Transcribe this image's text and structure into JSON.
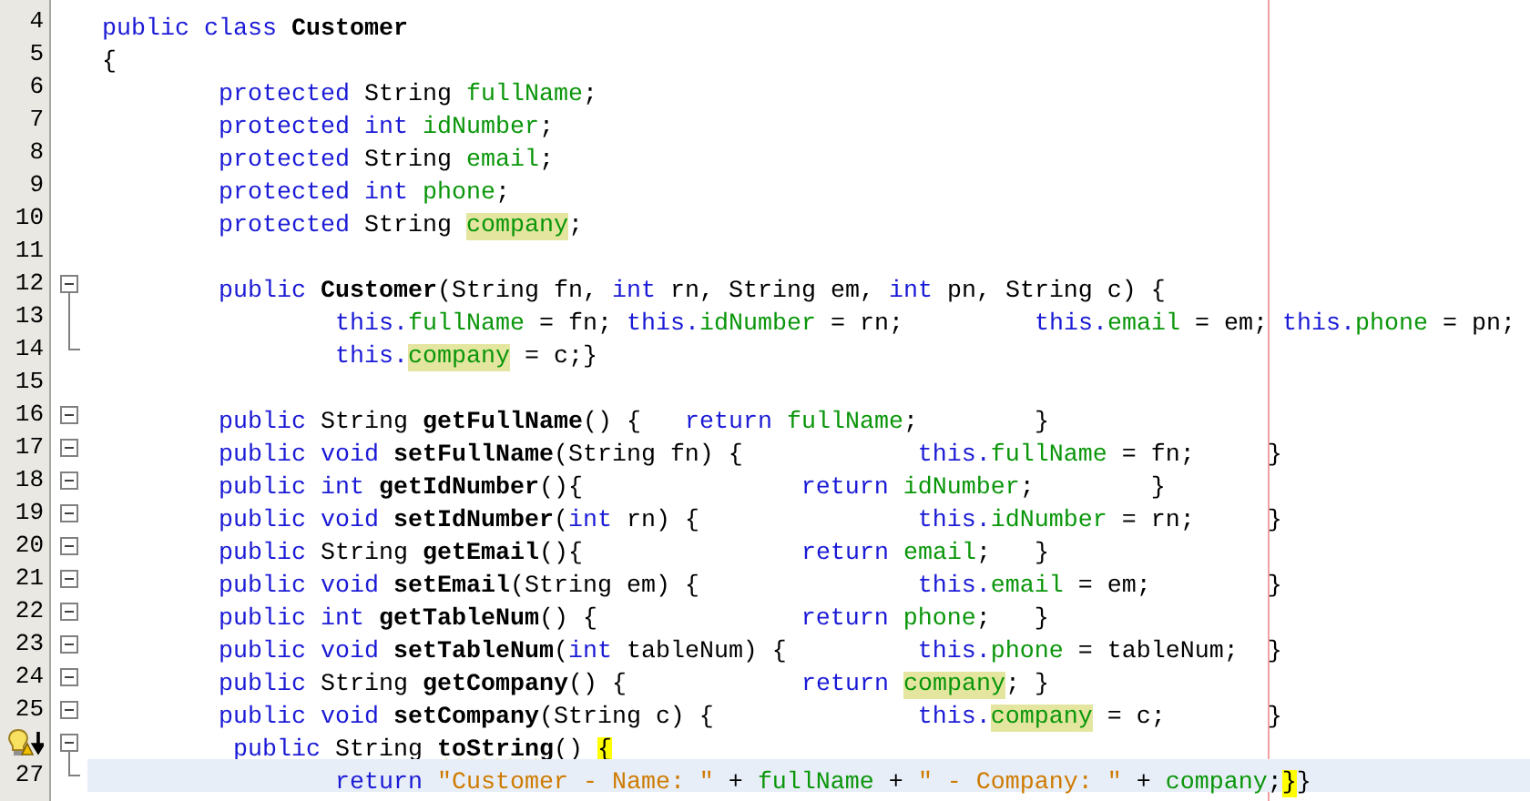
{
  "editor": {
    "lines": [
      {
        "number": "4",
        "tokens": [
          {
            "text": "public class ",
            "kind": "keyword"
          },
          {
            "text": "Customer",
            "kind": "declaration"
          }
        ]
      },
      {
        "number": "5",
        "tokens": [
          {
            "text": "{",
            "kind": "plain"
          }
        ]
      },
      {
        "number": "6",
        "tokens": [
          {
            "text": "        protected",
            "kind": "keyword"
          },
          {
            "text": " String ",
            "kind": "plain"
          },
          {
            "text": "fullName",
            "kind": "field"
          },
          {
            "text": ";",
            "kind": "plain"
          }
        ]
      },
      {
        "number": "7",
        "tokens": [
          {
            "text": "        protected int ",
            "kind": "keyword"
          },
          {
            "text": "idNumber",
            "kind": "field"
          },
          {
            "text": ";",
            "kind": "plain"
          }
        ]
      },
      {
        "number": "8",
        "tokens": [
          {
            "text": "        protected",
            "kind": "keyword"
          },
          {
            "text": " String ",
            "kind": "plain"
          },
          {
            "text": "email",
            "kind": "field"
          },
          {
            "text": ";",
            "kind": "plain"
          }
        ]
      },
      {
        "number": "9",
        "tokens": [
          {
            "text": "        protected int ",
            "kind": "keyword"
          },
          {
            "text": "phone",
            "kind": "field"
          },
          {
            "text": ";",
            "kind": "plain"
          }
        ]
      },
      {
        "number": "10",
        "tokens": [
          {
            "text": "        protected",
            "kind": "keyword"
          },
          {
            "text": " String ",
            "kind": "plain"
          },
          {
            "text": "company",
            "kind": "field",
            "highlighted": true
          },
          {
            "text": ";",
            "kind": "plain"
          }
        ]
      },
      {
        "number": "11"
      },
      {
        "number": "12",
        "fold": {
          "kind": "start"
        },
        "tokens": [
          {
            "text": "        public ",
            "kind": "keyword"
          },
          {
            "text": "Customer",
            "kind": "declaration"
          },
          {
            "text": "(String fn, ",
            "kind": "plain"
          },
          {
            "text": "int",
            "kind": "keyword"
          },
          {
            "text": " rn, String em, ",
            "kind": "plain"
          },
          {
            "text": "int",
            "kind": "keyword"
          },
          {
            "text": " pn, String c) {",
            "kind": "plain"
          }
        ]
      },
      {
        "number": "13",
        "fold": {
          "kind": "body"
        },
        "tokens": [
          {
            "text": "                this.",
            "kind": "keyword"
          },
          {
            "text": "fullName",
            "kind": "field"
          },
          {
            "text": " = fn; ",
            "kind": "plain"
          },
          {
            "text": "this.",
            "kind": "keyword"
          },
          {
            "text": "idNumber",
            "kind": "field"
          },
          {
            "text": " = rn;         ",
            "kind": "plain"
          },
          {
            "text": "this.",
            "kind": "keyword"
          },
          {
            "text": "email",
            "kind": "field"
          },
          {
            "text": " = em; ",
            "kind": "plain"
          },
          {
            "text": "this.",
            "kind": "keyword"
          },
          {
            "text": "phone",
            "kind": "field"
          },
          {
            "text": " = pn;",
            "kind": "plain"
          }
        ]
      },
      {
        "number": "14",
        "fold": {
          "kind": "end"
        },
        "tokens": [
          {
            "text": "                this.",
            "kind": "keyword"
          },
          {
            "text": "company",
            "kind": "field",
            "highlighted": true
          },
          {
            "text": " = c;}",
            "kind": "plain"
          }
        ]
      },
      {
        "number": "15"
      },
      {
        "number": "16",
        "fold": {
          "kind": "single"
        },
        "tokens": [
          {
            "text": "        public",
            "kind": "keyword"
          },
          {
            "text": " String ",
            "kind": "plain"
          },
          {
            "text": "getFullName",
            "kind": "method"
          },
          {
            "text": "() {   ",
            "kind": "plain"
          },
          {
            "text": "return ",
            "kind": "keyword"
          },
          {
            "text": "fullName",
            "kind": "field"
          },
          {
            "text": ";        }",
            "kind": "plain"
          }
        ]
      },
      {
        "number": "17",
        "fold": {
          "kind": "single"
        },
        "tokens": [
          {
            "text": "        public void ",
            "kind": "keyword"
          },
          {
            "text": "setFullName",
            "kind": "method"
          },
          {
            "text": "(String fn) {            ",
            "kind": "plain"
          },
          {
            "text": "this.",
            "kind": "keyword"
          },
          {
            "text": "fullName",
            "kind": "field"
          },
          {
            "text": " = fn;     }",
            "kind": "plain"
          }
        ]
      },
      {
        "number": "18",
        "fold": {
          "kind": "single"
        },
        "tokens": [
          {
            "text": "        public int ",
            "kind": "keyword"
          },
          {
            "text": "getIdNumber",
            "kind": "method"
          },
          {
            "text": "(){               ",
            "kind": "plain"
          },
          {
            "text": "return ",
            "kind": "keyword"
          },
          {
            "text": "idNumber",
            "kind": "field"
          },
          {
            "text": ";        }",
            "kind": "plain"
          }
        ]
      },
      {
        "number": "19",
        "fold": {
          "kind": "single"
        },
        "tokens": [
          {
            "text": "        public void ",
            "kind": "keyword"
          },
          {
            "text": "setIdNumber",
            "kind": "method"
          },
          {
            "text": "(",
            "kind": "plain"
          },
          {
            "text": "int",
            "kind": "keyword"
          },
          {
            "text": " rn) {               ",
            "kind": "plain"
          },
          {
            "text": "this.",
            "kind": "keyword"
          },
          {
            "text": "idNumber",
            "kind": "field"
          },
          {
            "text": " = rn;     }",
            "kind": "plain"
          }
        ]
      },
      {
        "number": "20",
        "fold": {
          "kind": "single"
        },
        "tokens": [
          {
            "text": "        public",
            "kind": "keyword"
          },
          {
            "text": " String ",
            "kind": "plain"
          },
          {
            "text": "getEmail",
            "kind": "method"
          },
          {
            "text": "(){               ",
            "kind": "plain"
          },
          {
            "text": "return ",
            "kind": "keyword"
          },
          {
            "text": "email",
            "kind": "field"
          },
          {
            "text": ";   }",
            "kind": "plain"
          }
        ]
      },
      {
        "number": "21",
        "fold": {
          "kind": "single"
        },
        "tokens": [
          {
            "text": "        public void ",
            "kind": "keyword"
          },
          {
            "text": "setEmail",
            "kind": "method"
          },
          {
            "text": "(String em) {               ",
            "kind": "plain"
          },
          {
            "text": "this.",
            "kind": "keyword"
          },
          {
            "text": "email",
            "kind": "field"
          },
          {
            "text": " = em;        }",
            "kind": "plain"
          }
        ]
      },
      {
        "number": "22",
        "fold": {
          "kind": "single"
        },
        "tokens": [
          {
            "text": "        public int ",
            "kind": "keyword"
          },
          {
            "text": "getTableNum",
            "kind": "method"
          },
          {
            "text": "() {              ",
            "kind": "plain"
          },
          {
            "text": "return ",
            "kind": "keyword"
          },
          {
            "text": "phone",
            "kind": "field"
          },
          {
            "text": ";   }",
            "kind": "plain"
          }
        ]
      },
      {
        "number": "23",
        "fold": {
          "kind": "single"
        },
        "tokens": [
          {
            "text": "        public void ",
            "kind": "keyword"
          },
          {
            "text": "setTableNum",
            "kind": "method"
          },
          {
            "text": "(",
            "kind": "plain"
          },
          {
            "text": "int",
            "kind": "keyword"
          },
          {
            "text": " tableNum) {         ",
            "kind": "plain"
          },
          {
            "text": "this.",
            "kind": "keyword"
          },
          {
            "text": "phone",
            "kind": "field"
          },
          {
            "text": " = tableNum;  }",
            "kind": "plain"
          }
        ]
      },
      {
        "number": "24",
        "fold": {
          "kind": "single"
        },
        "tokens": [
          {
            "text": "        public",
            "kind": "keyword"
          },
          {
            "text": " String ",
            "kind": "plain"
          },
          {
            "text": "getCompany",
            "kind": "method"
          },
          {
            "text": "() {            ",
            "kind": "plain"
          },
          {
            "text": "return ",
            "kind": "keyword"
          },
          {
            "text": "company",
            "kind": "field",
            "highlighted": true
          },
          {
            "text": "; }",
            "kind": "plain"
          }
        ]
      },
      {
        "number": "25",
        "fold": {
          "kind": "single"
        },
        "tokens": [
          {
            "text": "        public void ",
            "kind": "keyword"
          },
          {
            "text": "setCompany",
            "kind": "method"
          },
          {
            "text": "(String c) {              ",
            "kind": "plain"
          },
          {
            "text": "this.",
            "kind": "keyword"
          },
          {
            "text": "company",
            "kind": "field",
            "highlighted": true
          },
          {
            "text": " = c;       }",
            "kind": "plain"
          }
        ]
      },
      {
        "marker": {
          "kind": "hint"
        },
        "fold": {
          "kind": "start"
        },
        "tokens": [
          {
            "text": "         public",
            "kind": "keyword"
          },
          {
            "text": " String ",
            "kind": "plain"
          },
          {
            "text": "toString",
            "kind": "method",
            "warning": true
          },
          {
            "text": "() ",
            "kind": "plain"
          },
          {
            "text": "{",
            "kind": "matched_brace"
          }
        ]
      },
      {
        "number": "27",
        "fold": {
          "kind": "end"
        },
        "current": true,
        "tokens": [
          {
            "text": "                return ",
            "kind": "keyword"
          },
          {
            "text": "\"Customer - Name: \"",
            "kind": "string"
          },
          {
            "text": " + ",
            "kind": "plain"
          },
          {
            "text": "fullName",
            "kind": "field"
          },
          {
            "text": " + ",
            "kind": "plain"
          },
          {
            "text": "\" - Company: \"",
            "kind": "string"
          },
          {
            "text": " + ",
            "kind": "plain"
          },
          {
            "text": "company",
            "kind": "field"
          },
          {
            "text": ";",
            "kind": "plain"
          },
          {
            "text": "}",
            "kind": "matched_brace"
          },
          {
            "text": "}",
            "kind": "plain"
          }
        ]
      }
    ]
  }
}
